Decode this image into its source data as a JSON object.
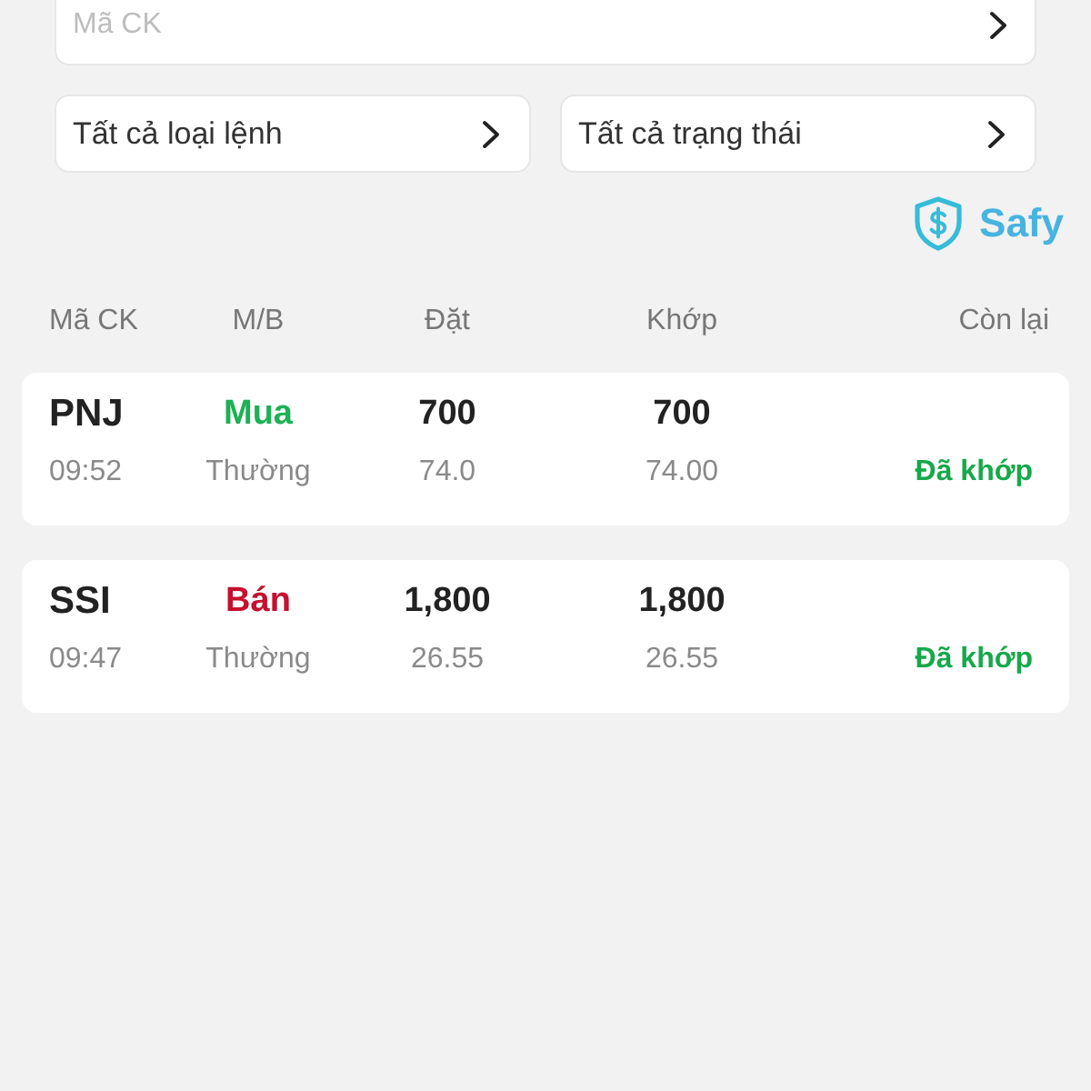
{
  "search_field": {
    "placeholder": "Mã CK"
  },
  "filters": [
    {
      "label": "Tất cả loại lệnh"
    },
    {
      "label": "Tất cả trạng thái"
    }
  ],
  "brand": {
    "name": "Safy"
  },
  "table": {
    "columns": [
      "Mã CK",
      "M/B",
      "Đặt",
      "Khớp",
      "Còn lại"
    ],
    "rows": [
      {
        "symbol": "PNJ",
        "time": "09:52",
        "side": "Mua",
        "kind": "buy",
        "order_type": "Thường",
        "order_quantity": "700",
        "order_price": "74.0",
        "matched_quantity": "700",
        "matched_price": "74.00",
        "status": "Đã khớp"
      },
      {
        "symbol": "SSI",
        "time": "09:47",
        "side": "Bán",
        "kind": "sell",
        "order_type": "Thường",
        "order_quantity": "1,800",
        "order_price": "26.55",
        "matched_quantity": "1,800",
        "matched_price": "26.55",
        "status": "Đã khớp"
      }
    ]
  }
}
